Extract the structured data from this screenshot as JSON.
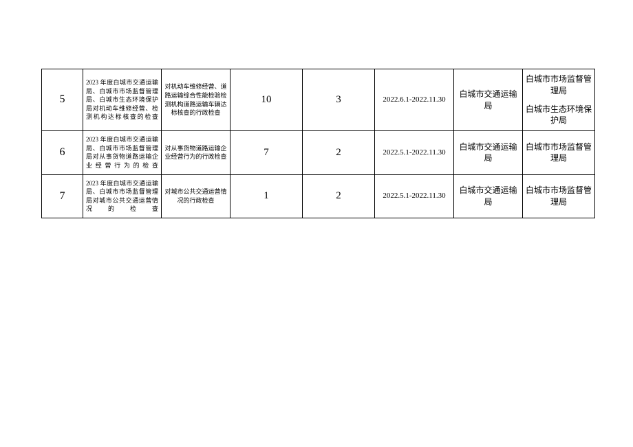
{
  "rows": [
    {
      "num": "5",
      "name": "2023 年度白城市交通运输局、白城市市场监督管理局、白城市生态环境保护局对机动车维修经营、检测机构达标核查的检查",
      "item": "对机动车维修经营、道路运输综合性能检验检测机构道路运输车辆达标核查的行政检查",
      "n1": "10",
      "n2": "3",
      "date": "2022.6.1-2022.11.30",
      "dept": "白城市交通运输局",
      "coop1": "白城市市场监督管理局",
      "coop2": "白城市生态环境保护局"
    },
    {
      "num": "6",
      "name": "2023 年度白城市交通运输局、白城市市场监督管理局对从事货物道路运输企业经营行为的检查",
      "item": "对从事货物道路运输企业经营行为的行政检查",
      "n1": "7",
      "n2": "2",
      "date": "2022.5.1-2022.11.30",
      "dept": "白城市交通运输局",
      "coop1": "白城市市场监督管理局",
      "coop2": ""
    },
    {
      "num": "7",
      "name": "2023 年度白城市交通运输局、白城市市场监督管理局对城市公共交通运营情况的检查",
      "item": "对城市公共交通运营情况的行政检查",
      "n1": "1",
      "n2": "2",
      "date": "2022.5.1-2022.11.30",
      "dept": "白城市交通运输局",
      "coop1": "白城市市场监督管理局",
      "coop2": ""
    }
  ]
}
